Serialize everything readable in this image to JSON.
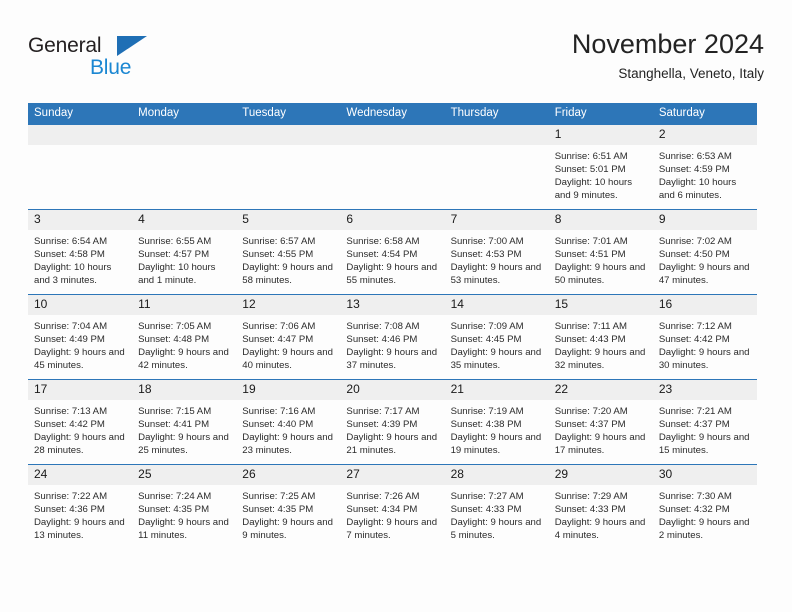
{
  "brand": {
    "name_top": "General",
    "name_bottom": "Blue",
    "color_dark": "#231f20",
    "color_blue": "#1b87d2",
    "triangle_color": "#1f6fb5"
  },
  "header": {
    "title": "November 2024",
    "subtitle": "Stanghella, Veneto, Italy"
  },
  "theme": {
    "header_bar": "#2d76b8",
    "daynum_band": "#efefef",
    "page_bg": "#fdfdfd",
    "text": "#2b2b2b"
  },
  "weekdays": [
    "Sunday",
    "Monday",
    "Tuesday",
    "Wednesday",
    "Thursday",
    "Friday",
    "Saturday"
  ],
  "weeks": [
    [
      {
        "day": "",
        "sunrise": "",
        "sunset": "",
        "daylight": ""
      },
      {
        "day": "",
        "sunrise": "",
        "sunset": "",
        "daylight": ""
      },
      {
        "day": "",
        "sunrise": "",
        "sunset": "",
        "daylight": ""
      },
      {
        "day": "",
        "sunrise": "",
        "sunset": "",
        "daylight": ""
      },
      {
        "day": "",
        "sunrise": "",
        "sunset": "",
        "daylight": ""
      },
      {
        "day": "1",
        "sunrise": "Sunrise: 6:51 AM",
        "sunset": "Sunset: 5:01 PM",
        "daylight": "Daylight: 10 hours and 9 minutes."
      },
      {
        "day": "2",
        "sunrise": "Sunrise: 6:53 AM",
        "sunset": "Sunset: 4:59 PM",
        "daylight": "Daylight: 10 hours and 6 minutes."
      }
    ],
    [
      {
        "day": "3",
        "sunrise": "Sunrise: 6:54 AM",
        "sunset": "Sunset: 4:58 PM",
        "daylight": "Daylight: 10 hours and 3 minutes."
      },
      {
        "day": "4",
        "sunrise": "Sunrise: 6:55 AM",
        "sunset": "Sunset: 4:57 PM",
        "daylight": "Daylight: 10 hours and 1 minute."
      },
      {
        "day": "5",
        "sunrise": "Sunrise: 6:57 AM",
        "sunset": "Sunset: 4:55 PM",
        "daylight": "Daylight: 9 hours and 58 minutes."
      },
      {
        "day": "6",
        "sunrise": "Sunrise: 6:58 AM",
        "sunset": "Sunset: 4:54 PM",
        "daylight": "Daylight: 9 hours and 55 minutes."
      },
      {
        "day": "7",
        "sunrise": "Sunrise: 7:00 AM",
        "sunset": "Sunset: 4:53 PM",
        "daylight": "Daylight: 9 hours and 53 minutes."
      },
      {
        "day": "8",
        "sunrise": "Sunrise: 7:01 AM",
        "sunset": "Sunset: 4:51 PM",
        "daylight": "Daylight: 9 hours and 50 minutes."
      },
      {
        "day": "9",
        "sunrise": "Sunrise: 7:02 AM",
        "sunset": "Sunset: 4:50 PM",
        "daylight": "Daylight: 9 hours and 47 minutes."
      }
    ],
    [
      {
        "day": "10",
        "sunrise": "Sunrise: 7:04 AM",
        "sunset": "Sunset: 4:49 PM",
        "daylight": "Daylight: 9 hours and 45 minutes."
      },
      {
        "day": "11",
        "sunrise": "Sunrise: 7:05 AM",
        "sunset": "Sunset: 4:48 PM",
        "daylight": "Daylight: 9 hours and 42 minutes."
      },
      {
        "day": "12",
        "sunrise": "Sunrise: 7:06 AM",
        "sunset": "Sunset: 4:47 PM",
        "daylight": "Daylight: 9 hours and 40 minutes."
      },
      {
        "day": "13",
        "sunrise": "Sunrise: 7:08 AM",
        "sunset": "Sunset: 4:46 PM",
        "daylight": "Daylight: 9 hours and 37 minutes."
      },
      {
        "day": "14",
        "sunrise": "Sunrise: 7:09 AM",
        "sunset": "Sunset: 4:45 PM",
        "daylight": "Daylight: 9 hours and 35 minutes."
      },
      {
        "day": "15",
        "sunrise": "Sunrise: 7:11 AM",
        "sunset": "Sunset: 4:43 PM",
        "daylight": "Daylight: 9 hours and 32 minutes."
      },
      {
        "day": "16",
        "sunrise": "Sunrise: 7:12 AM",
        "sunset": "Sunset: 4:42 PM",
        "daylight": "Daylight: 9 hours and 30 minutes."
      }
    ],
    [
      {
        "day": "17",
        "sunrise": "Sunrise: 7:13 AM",
        "sunset": "Sunset: 4:42 PM",
        "daylight": "Daylight: 9 hours and 28 minutes."
      },
      {
        "day": "18",
        "sunrise": "Sunrise: 7:15 AM",
        "sunset": "Sunset: 4:41 PM",
        "daylight": "Daylight: 9 hours and 25 minutes."
      },
      {
        "day": "19",
        "sunrise": "Sunrise: 7:16 AM",
        "sunset": "Sunset: 4:40 PM",
        "daylight": "Daylight: 9 hours and 23 minutes."
      },
      {
        "day": "20",
        "sunrise": "Sunrise: 7:17 AM",
        "sunset": "Sunset: 4:39 PM",
        "daylight": "Daylight: 9 hours and 21 minutes."
      },
      {
        "day": "21",
        "sunrise": "Sunrise: 7:19 AM",
        "sunset": "Sunset: 4:38 PM",
        "daylight": "Daylight: 9 hours and 19 minutes."
      },
      {
        "day": "22",
        "sunrise": "Sunrise: 7:20 AM",
        "sunset": "Sunset: 4:37 PM",
        "daylight": "Daylight: 9 hours and 17 minutes."
      },
      {
        "day": "23",
        "sunrise": "Sunrise: 7:21 AM",
        "sunset": "Sunset: 4:37 PM",
        "daylight": "Daylight: 9 hours and 15 minutes."
      }
    ],
    [
      {
        "day": "24",
        "sunrise": "Sunrise: 7:22 AM",
        "sunset": "Sunset: 4:36 PM",
        "daylight": "Daylight: 9 hours and 13 minutes."
      },
      {
        "day": "25",
        "sunrise": "Sunrise: 7:24 AM",
        "sunset": "Sunset: 4:35 PM",
        "daylight": "Daylight: 9 hours and 11 minutes."
      },
      {
        "day": "26",
        "sunrise": "Sunrise: 7:25 AM",
        "sunset": "Sunset: 4:35 PM",
        "daylight": "Daylight: 9 hours and 9 minutes."
      },
      {
        "day": "27",
        "sunrise": "Sunrise: 7:26 AM",
        "sunset": "Sunset: 4:34 PM",
        "daylight": "Daylight: 9 hours and 7 minutes."
      },
      {
        "day": "28",
        "sunrise": "Sunrise: 7:27 AM",
        "sunset": "Sunset: 4:33 PM",
        "daylight": "Daylight: 9 hours and 5 minutes."
      },
      {
        "day": "29",
        "sunrise": "Sunrise: 7:29 AM",
        "sunset": "Sunset: 4:33 PM",
        "daylight": "Daylight: 9 hours and 4 minutes."
      },
      {
        "day": "30",
        "sunrise": "Sunrise: 7:30 AM",
        "sunset": "Sunset: 4:32 PM",
        "daylight": "Daylight: 9 hours and 2 minutes."
      }
    ]
  ]
}
